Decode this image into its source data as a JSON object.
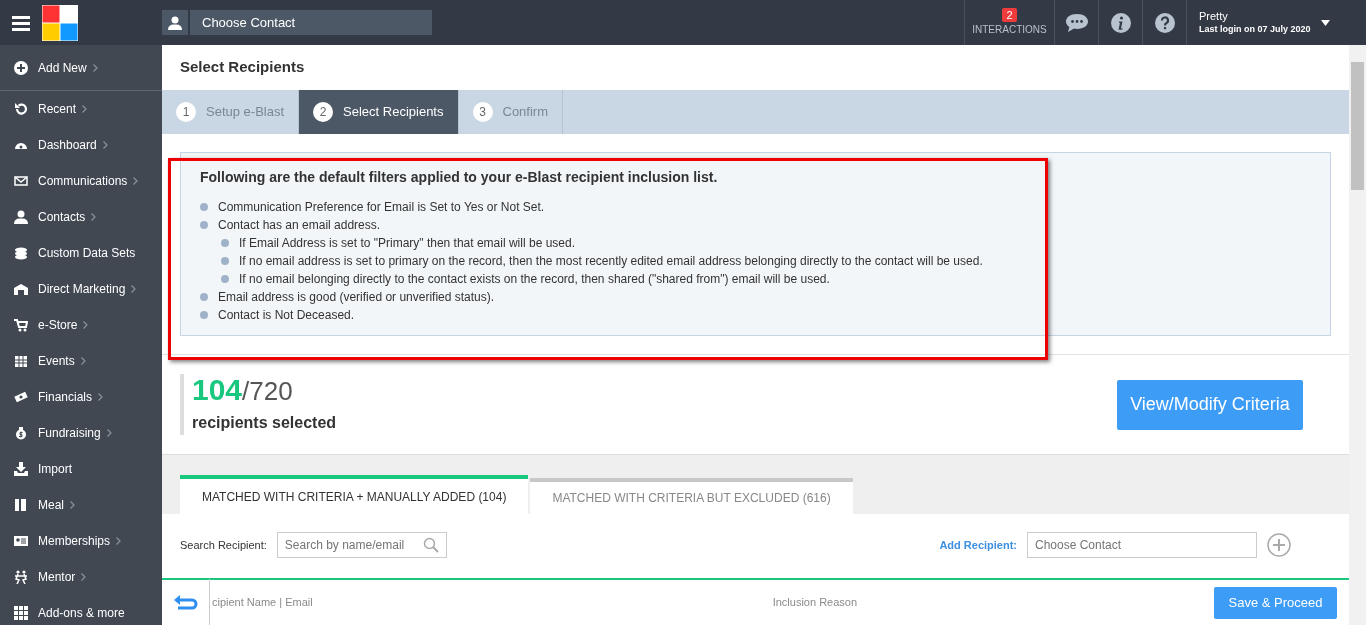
{
  "top_bar": {
    "contact_placeholder": "Choose Contact",
    "interactions": {
      "count": "2",
      "label": "INTERACTIONS"
    },
    "user": {
      "name": "Pretty",
      "last_login": "Last login on 07 July 2020"
    }
  },
  "sidebar": {
    "items": [
      {
        "label": "Add New",
        "has_submenu": true
      },
      {
        "label": "Recent",
        "has_submenu": true
      },
      {
        "label": "Dashboard",
        "has_submenu": true
      },
      {
        "label": "Communications",
        "has_submenu": true
      },
      {
        "label": "Contacts",
        "has_submenu": true
      },
      {
        "label": "Custom Data Sets",
        "has_submenu": false
      },
      {
        "label": "Direct Marketing",
        "has_submenu": true
      },
      {
        "label": "e-Store",
        "has_submenu": true
      },
      {
        "label": "Events",
        "has_submenu": true
      },
      {
        "label": "Financials",
        "has_submenu": true
      },
      {
        "label": "Fundraising",
        "has_submenu": true
      },
      {
        "label": "Import",
        "has_submenu": false
      },
      {
        "label": "Meal",
        "has_submenu": true
      },
      {
        "label": "Memberships",
        "has_submenu": true
      },
      {
        "label": "Mentor",
        "has_submenu": true
      },
      {
        "label": "Add-ons & more",
        "has_submenu": false
      }
    ]
  },
  "page_title": "Select Recipients",
  "steps": [
    {
      "number": "1",
      "label": "Setup e-Blast",
      "selected": false
    },
    {
      "number": "2",
      "label": "Select Recipients",
      "selected": true
    },
    {
      "number": "3",
      "label": "Confirm",
      "selected": false
    }
  ],
  "filters_panel": {
    "highlighted": true,
    "title": "Following are the default filters applied to your e-Blast recipient inclusion list.",
    "items": [
      {
        "text": "Communication Preference for Email is Set to Yes or Not Set."
      },
      {
        "text": "Contact has an email address.",
        "children": [
          {
            "text": "If Email Address is set to \"Primary\" then that email will be used."
          },
          {
            "text": "If no email address is set to primary on the record, then the most recently edited email address belonging directly to the contact will be used."
          },
          {
            "text": "If no email belonging directly to the contact exists on the record, then shared (\"shared from\") email will be used."
          }
        ]
      },
      {
        "text": "Email address is good (verified or unverified status)."
      },
      {
        "text": "Contact is Not Deceased."
      }
    ]
  },
  "summary": {
    "selected_count": "104",
    "total": "/720",
    "caption": "recipients selected",
    "button": "View/Modify Criteria"
  },
  "tabs": [
    {
      "label": "MATCHED WITH CRITERIA + MANUALLY ADDED (104)",
      "selected": true
    },
    {
      "label": "MATCHED WITH CRITERIA BUT EXCLUDED (616)",
      "selected": false
    }
  ],
  "search": {
    "label": "Search Recipient:",
    "placeholder": "Search by name/email"
  },
  "add_recipient": {
    "label": "Add Recipient:",
    "placeholder": "Choose Contact"
  },
  "table": {
    "columns": [
      "cipient Name | Email",
      "Inclusion Reason"
    ]
  },
  "footer": {
    "button": "Save & Proceed"
  }
}
